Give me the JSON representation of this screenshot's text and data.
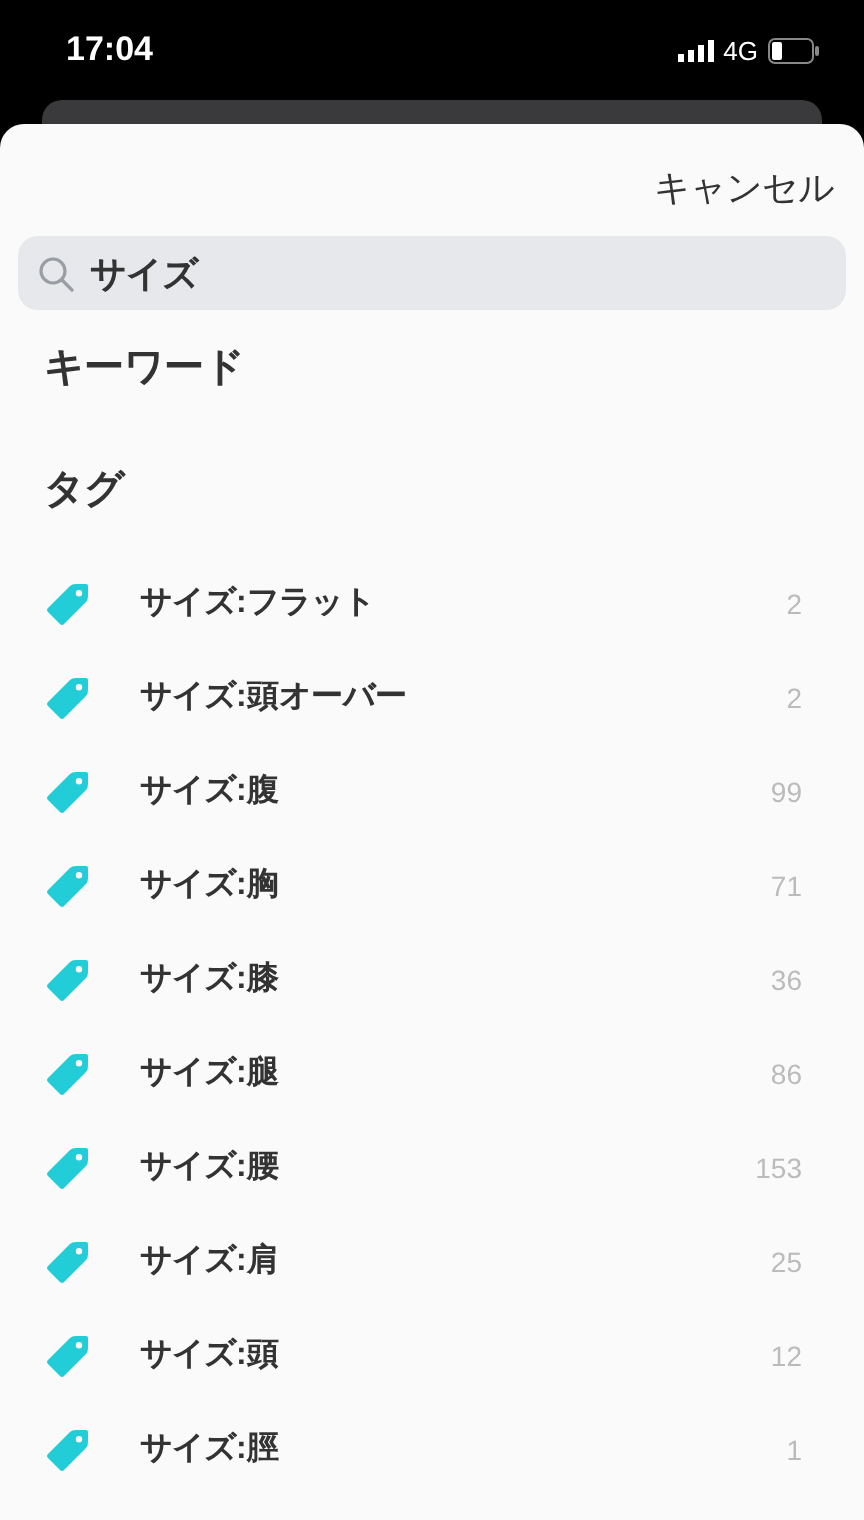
{
  "status_bar": {
    "time": "17:04",
    "network": "4G"
  },
  "cancel": "キャンセル",
  "search": {
    "value": "サイズ"
  },
  "keyword_heading": "キーワード",
  "tag_heading": "タグ",
  "tags": [
    {
      "label": "サイズ:フラット",
      "count": "2"
    },
    {
      "label": "サイズ:頭オーバー",
      "count": "2"
    },
    {
      "label": "サイズ:腹",
      "count": "99"
    },
    {
      "label": "サイズ:胸",
      "count": "71"
    },
    {
      "label": "サイズ:膝",
      "count": "36"
    },
    {
      "label": "サイズ:腿",
      "count": "86"
    },
    {
      "label": "サイズ:腰",
      "count": "153"
    },
    {
      "label": "サイズ:肩",
      "count": "25"
    },
    {
      "label": "サイズ:頭",
      "count": "12"
    },
    {
      "label": "サイズ:脛",
      "count": "1"
    }
  ]
}
